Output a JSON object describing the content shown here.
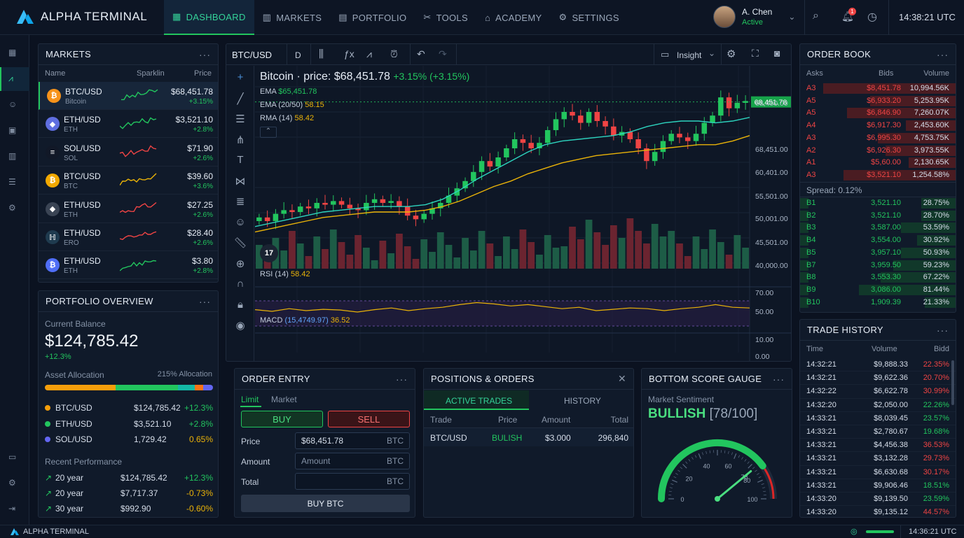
{
  "app": {
    "brand": "ALPHA TERMINAL",
    "time": "14:38:21 UTC",
    "notif_count": "1"
  },
  "nav": [
    {
      "label": "DASHBOARD"
    },
    {
      "label": "MARKETS"
    },
    {
      "label": "PORTFOLIO"
    },
    {
      "label": "TOOLS"
    },
    {
      "label": "ACADEMY"
    },
    {
      "label": "SETTINGS"
    }
  ],
  "user": {
    "name": "A. Chen",
    "status": "Active"
  },
  "markets": {
    "title": "MARKETS",
    "cols": [
      "Name",
      "Sparklin",
      "Price"
    ],
    "rows": [
      {
        "symbol": "BTC/USD",
        "sub": "Bitcoin",
        "price": "$68,451.78",
        "change": "+3.15%",
        "icon": "₿",
        "color": "#f7931a",
        "spark": "#22c55e"
      },
      {
        "symbol": "ETH/USD",
        "sub": "ETH",
        "price": "$3,521.10",
        "change": "+2.8%",
        "icon": "◆",
        "color": "#5f6ee0",
        "spark": "#22c55e"
      },
      {
        "symbol": "SOL/USD",
        "sub": "SOL",
        "price": "$71.90",
        "change": "+2.6%",
        "icon": "≡",
        "color": "#111827",
        "spark": "#ef4444"
      },
      {
        "symbol": "BTC/USD",
        "sub": "BTC",
        "price": "$39.60",
        "change": "+3.6%",
        "icon": "₿",
        "color": "#f2a900",
        "spark": "#eab308"
      },
      {
        "symbol": "ETH/USD",
        "sub": "ETH",
        "price": "$27.25",
        "change": "+2.6%",
        "icon": "◆",
        "color": "#3a4454",
        "spark": "#ef4444"
      },
      {
        "symbol": "ETH/USD",
        "sub": "ERO",
        "price": "$28.40",
        "change": "+2.6%",
        "icon": "ℍ",
        "color": "#1f3b4f",
        "spark": "#ef4444"
      },
      {
        "symbol": "ETH/USD",
        "sub": "ETH",
        "price": "$3.80",
        "change": "+2.8%",
        "icon": "₿",
        "color": "#4f6ef7",
        "spark": "#22c55e"
      }
    ]
  },
  "portfolio": {
    "title": "PORTFOLIO OVERVIEW",
    "balance_label": "Current Balance",
    "balance": "$124,785.42",
    "change": "+12.3%",
    "alloc_label": "Asset Allocation",
    "alloc_right": "215% Allocation",
    "alloc_bar": [
      {
        "frac": 0.42,
        "color": "#f59e0b"
      },
      {
        "frac": 0.37,
        "color": "#22c55e"
      },
      {
        "frac": 0.1,
        "color": "#14b8a6"
      },
      {
        "frac": 0.05,
        "color": "#f97316"
      },
      {
        "frac": 0.06,
        "color": "#6366f1"
      }
    ],
    "assets": [
      {
        "name": "BTC/USD",
        "value": "$124,785.42",
        "change": "+12.3%",
        "color": "#f59e0b",
        "cls": "green"
      },
      {
        "name": "ETH/USD",
        "value": "$3,521.10",
        "change": "+2.8%",
        "color": "#22c55e",
        "cls": "green"
      },
      {
        "name": "SOL/USD",
        "value": "1,729.42",
        "change": "0.65%",
        "color": "#6366f1",
        "cls": "yellow"
      }
    ],
    "perf_label": "Recent Performance",
    "perf": [
      {
        "period": "20 year",
        "value": "$124,785.42",
        "change": "+12.3%",
        "cls": "green"
      },
      {
        "period": "20 year",
        "value": "$7,717.37",
        "change": "-0.73%",
        "cls": "yellow"
      },
      {
        "period": "30 year",
        "value": "$992.90",
        "change": "-0.60%",
        "cls": "yellow"
      }
    ]
  },
  "chart": {
    "symbol": "BTC/USD",
    "interval": "D",
    "insight": "Insight",
    "title": "Bitcoin · price: $68,451.78",
    "title_change": "+3.15% (+3.15%)",
    "indicators": [
      {
        "name": "EMA",
        "value": "$65,451.78",
        "cls": "green"
      },
      {
        "name": "EMA (20/50)",
        "value": "58.15",
        "cls": "yellow"
      },
      {
        "name": "RMA (14)",
        "value": "58.42",
        "cls": "yellow"
      }
    ],
    "rsi_label": "RSI (14)",
    "rsi_value": "58.42",
    "macd_label": "MACD",
    "macd_params": "(15,4749.97)",
    "macd_value": "36.52",
    "current_price": "68,451.78",
    "price_ticks": [
      "68,400.00",
      "68,451.00",
      "60,401.00",
      "55,501.00",
      "50,001.00",
      "45,501.00",
      "40,000.00"
    ],
    "rsi_ticks": [
      "70.00",
      "50.00"
    ],
    "macd_ticks": [
      "10.00",
      "0.00"
    ],
    "x_labels": [
      "ᴅw",
      "Dec",
      "2022",
      "Feb",
      "Mar",
      "Apr",
      "May",
      "Jul",
      "Gup"
    ],
    "tv_logo": "17"
  },
  "chart_data": {
    "type": "candlestick",
    "series": [
      {
        "name": "EMA"
      },
      {
        "name": "EMA (20/50)"
      },
      {
        "name": "RMA (14)"
      }
    ],
    "candles": [
      [
        0.3,
        0.32
      ],
      [
        0.32,
        0.3
      ],
      [
        0.3,
        0.34
      ],
      [
        0.34,
        0.36
      ],
      [
        0.36,
        0.35
      ],
      [
        0.35,
        0.38
      ],
      [
        0.38,
        0.37
      ],
      [
        0.37,
        0.4
      ],
      [
        0.4,
        0.39
      ],
      [
        0.39,
        0.41
      ],
      [
        0.41,
        0.39
      ],
      [
        0.39,
        0.37
      ],
      [
        0.37,
        0.36
      ],
      [
        0.36,
        0.4
      ],
      [
        0.4,
        0.42
      ],
      [
        0.42,
        0.4
      ],
      [
        0.4,
        0.41
      ],
      [
        0.41,
        0.38
      ],
      [
        0.38,
        0.33
      ],
      [
        0.33,
        0.31
      ],
      [
        0.31,
        0.34
      ],
      [
        0.34,
        0.37
      ],
      [
        0.37,
        0.4
      ],
      [
        0.4,
        0.44
      ],
      [
        0.44,
        0.48
      ],
      [
        0.48,
        0.52
      ],
      [
        0.52,
        0.57
      ],
      [
        0.57,
        0.63
      ],
      [
        0.63,
        0.6
      ],
      [
        0.6,
        0.65
      ],
      [
        0.65,
        0.7
      ],
      [
        0.7,
        0.75
      ],
      [
        0.75,
        0.73
      ],
      [
        0.73,
        0.7
      ],
      [
        0.7,
        0.73
      ],
      [
        0.73,
        0.8
      ],
      [
        0.8,
        0.86
      ],
      [
        0.86,
        0.9
      ],
      [
        0.9,
        0.88
      ],
      [
        0.88,
        0.84
      ],
      [
        0.84,
        0.9
      ],
      [
        0.9,
        0.85
      ],
      [
        0.85,
        0.82
      ],
      [
        0.82,
        0.77
      ],
      [
        0.77,
        0.79
      ],
      [
        0.79,
        0.75
      ],
      [
        0.75,
        0.7
      ],
      [
        0.7,
        0.63
      ],
      [
        0.63,
        0.68
      ],
      [
        0.68,
        0.74
      ],
      [
        0.74,
        0.78
      ],
      [
        0.78,
        0.76
      ],
      [
        0.76,
        0.74
      ],
      [
        0.74,
        0.78
      ],
      [
        0.78,
        0.84
      ],
      [
        0.84,
        0.88
      ],
      [
        0.88,
        0.98
      ],
      [
        0.98,
        0.92
      ],
      [
        0.92,
        0.95
      ],
      [
        0.95,
        0.96
      ]
    ],
    "ema": [
      0.27,
      0.29,
      0.31,
      0.33,
      0.35,
      0.36,
      0.37,
      0.38,
      0.38,
      0.38,
      0.39,
      0.42,
      0.47,
      0.53,
      0.58,
      0.63,
      0.68,
      0.72,
      0.74,
      0.75,
      0.76,
      0.77,
      0.79,
      0.82,
      0.84,
      0.85,
      0.85,
      0.84,
      0.85,
      0.87
    ],
    "ema2": [
      0.24,
      0.26,
      0.28,
      0.3,
      0.32,
      0.33,
      0.34,
      0.35,
      0.35,
      0.35,
      0.36,
      0.38,
      0.41,
      0.45,
      0.49,
      0.52,
      0.56,
      0.59,
      0.62,
      0.64,
      0.66,
      0.67,
      0.68,
      0.69,
      0.7,
      0.71,
      0.72,
      0.72,
      0.74,
      0.77
    ],
    "rsi": [
      0.55,
      0.5,
      0.58,
      0.52,
      0.56,
      0.54,
      0.48,
      0.55,
      0.6,
      0.52,
      0.58,
      0.62,
      0.7,
      0.76,
      0.72,
      0.66,
      0.7,
      0.64,
      0.58,
      0.62,
      0.52,
      0.56,
      0.6,
      0.58,
      0.52,
      0.58,
      0.62,
      0.7,
      0.62,
      0.6
    ]
  },
  "chart_tools": [
    "crosshair",
    "trendline",
    "horizontal-lines",
    "pitchfork",
    "text",
    "pattern",
    "fib",
    "emoji",
    "ruler",
    "zoom",
    "magnet",
    "lock",
    "eye"
  ],
  "order_entry": {
    "title": "ORDER ENTRY",
    "tabs": [
      "Limit",
      "Market"
    ],
    "buy": "BUY",
    "sell": "SELL",
    "price_label": "Price",
    "price_value": "$68,451.78",
    "amount_label": "Amount",
    "amount_placeholder": "Amount",
    "total_label": "Total",
    "unit": "BTC",
    "submit": "BUY BTC"
  },
  "positions": {
    "title": "POSITIONS & ORDERS",
    "tabs": [
      "ACTIVE TRADES",
      "HISTORY"
    ],
    "cols": [
      "Trade",
      "Price",
      "Amount",
      "Total"
    ],
    "row": {
      "trade": "BTC/USD",
      "price": "BULISH",
      "amount": "$3.000",
      "total": "296,840"
    }
  },
  "gauge": {
    "title": "BOTTOM SCORE GAUGE",
    "label": "Market Sentiment",
    "value_text": "BULLISH",
    "score": "[78/100]",
    "value": 78,
    "ticks": [
      "0",
      "20",
      "40",
      "60",
      "78",
      "80",
      "100"
    ]
  },
  "orderbook": {
    "title": "ORDER BOOK",
    "cols": [
      "Asks",
      "Bids",
      "Volume"
    ],
    "asks": [
      {
        "l": "A3",
        "p": "$8,451.78",
        "v": "10,994.56K",
        "w": 0.85
      },
      {
        "l": "A5",
        "p": "$6,933.20",
        "v": "5,253.95K",
        "w": 0.55
      },
      {
        "l": "A5",
        "p": "$6,846.90",
        "v": "7,260.07K",
        "w": 0.7
      },
      {
        "l": "A4",
        "p": "$6,917.30",
        "v": "2,453.60K",
        "w": 0.32
      },
      {
        "l": "A3",
        "p": "$6,995.30",
        "v": "4,753.75K",
        "w": 0.5
      },
      {
        "l": "A2",
        "p": "$6,926.30",
        "v": "3,973.55K",
        "w": 0.45
      },
      {
        "l": "A1",
        "p": "$5,60.00",
        "v": "2,130.65K",
        "w": 0.3
      },
      {
        "l": "A3",
        "p": "$3,521.10",
        "v": "1,254.58%",
        "w": 0.72
      }
    ],
    "spread": "Spread: 0.12%",
    "bids": [
      {
        "l": "B1",
        "p": "3,521.10",
        "v": "28.75%",
        "w": 0.22
      },
      {
        "l": "B2",
        "p": "3,521.10",
        "v": "28.70%",
        "w": 0.22
      },
      {
        "l": "B3",
        "p": "3,587.00",
        "v": "53.59%",
        "w": 0.35
      },
      {
        "l": "B4",
        "p": "3,554.00",
        "v": "30.92%",
        "w": 0.25
      },
      {
        "l": "B5",
        "p": "3,957.10",
        "v": "50.93%",
        "w": 0.35
      },
      {
        "l": "B7",
        "p": "3,959.50",
        "v": "59.23%",
        "w": 0.4
      },
      {
        "l": "B8",
        "p": "3,553.30",
        "v": "67.22%",
        "w": 0.48
      },
      {
        "l": "B9",
        "p": "3,086.00",
        "v": "81.44%",
        "w": 0.62
      },
      {
        "l": "B10",
        "p": "1,909.39",
        "v": "21.33%",
        "w": 0.2
      }
    ]
  },
  "trades": {
    "title": "TRADE HISTORY",
    "cols": [
      "Time",
      "Volume",
      "Bidd"
    ],
    "rows": [
      [
        "14:32:21",
        "$9,888.33",
        "22.35%",
        "red"
      ],
      [
        "14:32:21",
        "$9,622.36",
        "20.70%",
        "red"
      ],
      [
        "14:32:22",
        "$6,622.78",
        "30.99%",
        "red"
      ],
      [
        "14:32:20",
        "$2,050.00",
        "22.26%",
        "green"
      ],
      [
        "14:33:21",
        "$8,039.45",
        "23.57%",
        "green"
      ],
      [
        "14:33:21",
        "$2,780.67",
        "19.68%",
        "green"
      ],
      [
        "14:33:21",
        "$4,456.38",
        "36.53%",
        "red"
      ],
      [
        "14:33:21",
        "$3,132.28",
        "29.73%",
        "red"
      ],
      [
        "14:33:21",
        "$6,630.68",
        "30.17%",
        "red"
      ],
      [
        "14:33:21",
        "$9,906.46",
        "18.51%",
        "green"
      ],
      [
        "14:33:20",
        "$9,139.50",
        "23.59%",
        "green"
      ],
      [
        "14:33:20",
        "$9,135.12",
        "44.57%",
        "red"
      ]
    ]
  },
  "footer": {
    "brand": "ALPHA TERMINAL",
    "time": "14:36:21 UTC"
  },
  "colors": {
    "up": "#22c55e",
    "down": "#ef4444",
    "accent": "#34d399"
  }
}
